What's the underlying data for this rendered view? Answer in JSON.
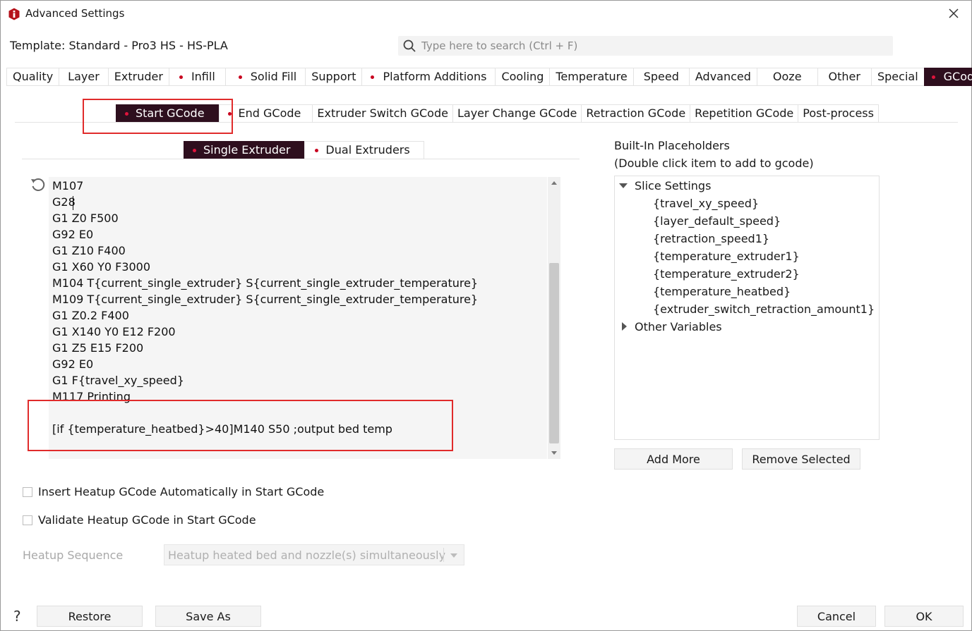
{
  "window": {
    "title": "Advanced Settings",
    "close_glyph": "✕"
  },
  "template": {
    "label": "Template: Standard - Pro3 HS - HS-PLA"
  },
  "search": {
    "placeholder": "Type here to search (Ctrl + F)",
    "value": ""
  },
  "main_tabs": [
    {
      "label": "Quality",
      "dot": false
    },
    {
      "label": "Layer",
      "dot": false
    },
    {
      "label": "Extruder",
      "dot": false
    },
    {
      "label": "Infill",
      "dot": true
    },
    {
      "label": "Solid Fill",
      "dot": true
    },
    {
      "label": "Support",
      "dot": false
    },
    {
      "label": "Platform Additions",
      "dot": true
    },
    {
      "label": "Cooling",
      "dot": false
    },
    {
      "label": "Temperature",
      "dot": false
    },
    {
      "label": "Speed",
      "dot": false
    },
    {
      "label": "Advanced",
      "dot": false
    },
    {
      "label": "Ooze",
      "dot": false
    },
    {
      "label": "Other",
      "dot": false
    },
    {
      "label": "Special",
      "dot": false
    },
    {
      "label": "GCode",
      "dot": true,
      "active": true
    }
  ],
  "gcode_tabs": [
    {
      "label": "Start GCode",
      "dot": true,
      "active": true
    },
    {
      "label": "End GCode",
      "dot": true
    },
    {
      "label": "Extruder Switch GCode",
      "dot": false
    },
    {
      "label": "Layer Change GCode",
      "dot": false
    },
    {
      "label": "Retraction GCode",
      "dot": false
    },
    {
      "label": "Repetition GCode",
      "dot": false
    },
    {
      "label": "Post-process",
      "dot": false
    }
  ],
  "extruder_tabs": [
    {
      "label": "Single Extruder",
      "dot": true,
      "active": true
    },
    {
      "label": "Dual Extruders",
      "dot": true
    }
  ],
  "editor": {
    "lines": [
      "M107",
      "G28",
      "G1 Z0 F500",
      "G92 E0",
      "G1 Z10 F400",
      "G1 X60 Y0 F3000",
      "M104 T{current_single_extruder} S{current_single_extruder_temperature}",
      "M109 T{current_single_extruder} S{current_single_extruder_temperature}",
      "G1 Z0.2 F400",
      "G1 X140 Y0 E12 F200",
      "G1 Z5 E15 F200",
      "G92 E0",
      "G1 F{travel_xy_speed}",
      "M117 Printing",
      "",
      "[if {temperature_heatbed}>40]M140 S50 ;output bed temp"
    ]
  },
  "placeholders": {
    "title_line1": "Built-In Placeholders",
    "title_line2": "(Double click item to add to gcode)",
    "groups": [
      {
        "label": "Slice Settings",
        "expanded": true,
        "items": [
          "{travel_xy_speed}",
          "{layer_default_speed}",
          "{retraction_speed1}",
          "{temperature_extruder1}",
          "{temperature_extruder2}",
          "{temperature_heatbed}",
          "{extruder_switch_retraction_amount1}"
        ]
      },
      {
        "label": "Other Variables",
        "expanded": false,
        "items": []
      }
    ],
    "add_more_label": "Add More",
    "remove_selected_label": "Remove Selected"
  },
  "options": {
    "insert_heatup_label": "Insert Heatup GCode Automatically in Start GCode",
    "insert_heatup_checked": false,
    "validate_heatup_label": "Validate Heatup GCode in Start GCode",
    "validate_heatup_checked": false,
    "heatup_sequence_label": "Heatup Sequence",
    "heatup_sequence_value": "Heatup heated bed and nozzle(s) simultaneously"
  },
  "footer": {
    "help_glyph": "?",
    "restore_label": "Restore",
    "save_as_label": "Save As",
    "cancel_label": "Cancel",
    "ok_label": "OK"
  },
  "colors": {
    "active_tab_bg": "#2e0f1e",
    "dot_red": "#c8001e",
    "annotation_red": "#e02b2b"
  }
}
